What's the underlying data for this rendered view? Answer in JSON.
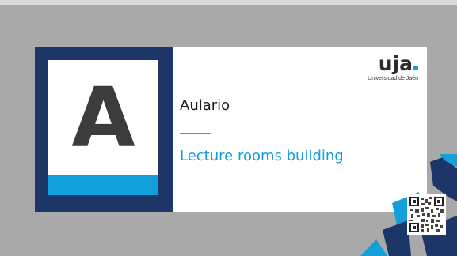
{
  "sign": {
    "letter": "A",
    "title_es": "Aulario",
    "title_en": "Lecture rooms building"
  },
  "logo": {
    "mark": "uja",
    "subtitle": "Universidad de Jaén"
  },
  "colors": {
    "navy": "#1c3668",
    "cyan": "#139fd9",
    "background": "#a9a9a9"
  },
  "icons": [
    "qr-code-icon"
  ]
}
